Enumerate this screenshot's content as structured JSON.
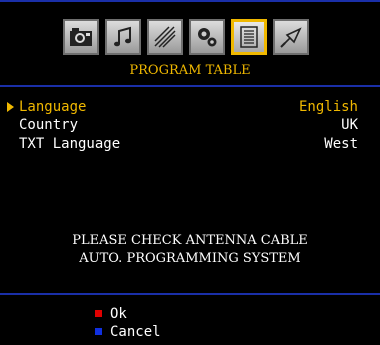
{
  "menu": {
    "title": "PROGRAM TABLE",
    "icons": [
      "picture-icon",
      "sound-icon",
      "feature-icon",
      "setup-icon",
      "program-table-icon",
      "source-icon"
    ],
    "active_icon": "program-table-icon"
  },
  "settings": [
    {
      "label": "Language",
      "value": "English",
      "selected": true
    },
    {
      "label": "Country",
      "value": "UK",
      "selected": false
    },
    {
      "label": "TXT Language",
      "value": "West",
      "selected": false
    }
  ],
  "message": {
    "line1": "PLEASE CHECK ANTENNA CABLE",
    "line2": "AUTO. PROGRAMMING SYSTEM"
  },
  "footer": {
    "ok": {
      "label": "Ok",
      "color": "#e00000"
    },
    "cancel": {
      "label": "Cancel",
      "color": "#1030e0"
    }
  },
  "colors": {
    "accent": "#f0b800",
    "divider": "#1a2fa8",
    "background": "#000000"
  }
}
